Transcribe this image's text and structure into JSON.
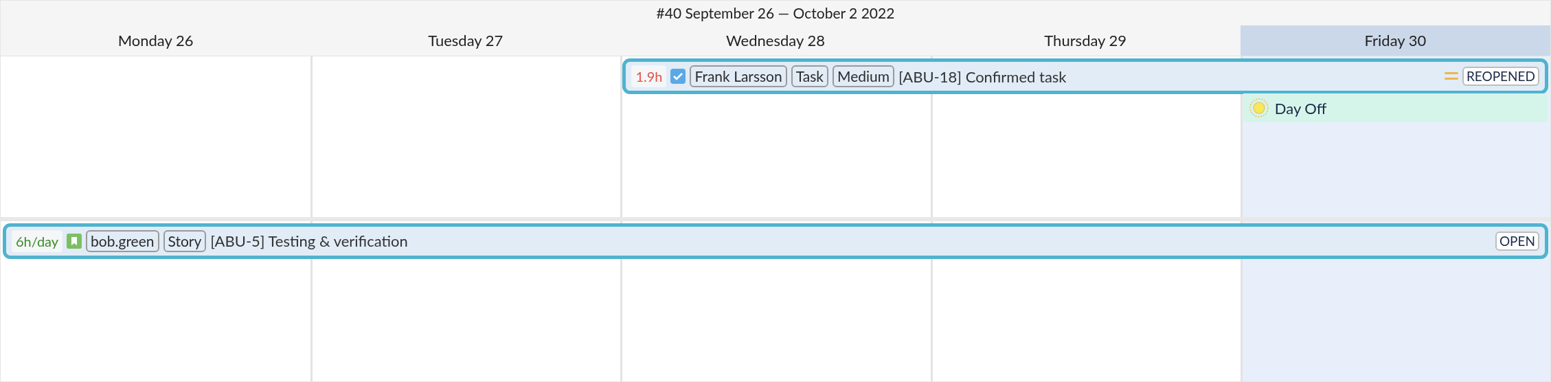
{
  "title": "#40 September 26 — October 2 2022",
  "days": [
    {
      "label": "Monday 26",
      "selected": false
    },
    {
      "label": "Tuesday 27",
      "selected": false
    },
    {
      "label": "Wednesday 28",
      "selected": false
    },
    {
      "label": "Thursday 29",
      "selected": false
    },
    {
      "label": "Friday 30",
      "selected": true
    }
  ],
  "weeks": [
    {
      "cells": [
        {},
        {},
        {
          "events": [
            {
              "kind": "task",
              "estimate": "1.9h",
              "color": "#e5534b",
              "tags": [
                "Frank Larsson",
                "Task",
                "Medium"
              ],
              "summary": "[ABU-18] Confirmed task",
              "priority_marked": true,
              "status": "REOPENED",
              "continues": true,
              "highlighted": true
            }
          ]
        },
        {},
        {
          "events": [
            {
              "kind": "day_off",
              "label": "Day Off"
            }
          ]
        }
      ]
    },
    {
      "cells": [
        {
          "events": [
            {
              "kind": "story",
              "estimate": "6h/day",
              "color": "#3d8b2a",
              "tags": [
                "bob.green",
                "Story"
              ],
              "summary": "[ABU-5] Testing & verification",
              "status": "OPEN",
              "continues": true,
              "highlighted": true
            }
          ]
        },
        {},
        {},
        {},
        {}
      ]
    }
  ]
}
